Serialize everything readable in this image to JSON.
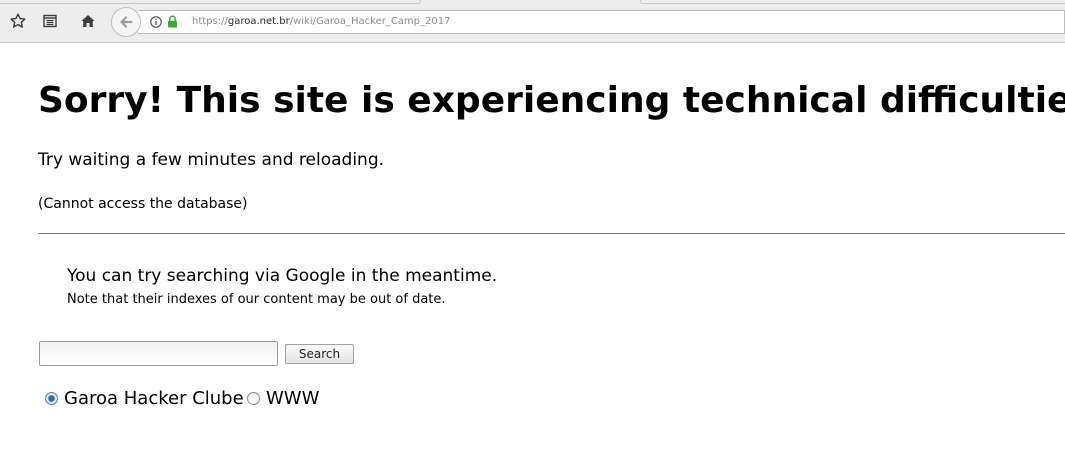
{
  "browser": {
    "url_prefix": "https://",
    "url_host": "garoa.net.br",
    "url_path": "/wiki/Garoa_Hacker_Camp_2017",
    "icons": {
      "bookmark": "star-icon",
      "reader": "reader-view-icon",
      "home": "home-icon",
      "back": "back-arrow-icon",
      "info": "info-icon",
      "lock": "lock-icon"
    },
    "lock_color": "#3aa935"
  },
  "error": {
    "title": "Sorry! This site is experiencing technical difficulties.",
    "message": "Try waiting a few minutes and reloading.",
    "detail": "(Cannot access the database)"
  },
  "search": {
    "lead": "You can try searching via Google in the meantime.",
    "note": "Note that their indexes of our content may be out of date.",
    "input_value": "",
    "button_label": "Search",
    "options": [
      {
        "label": "Garoa Hacker Clube",
        "checked": true
      },
      {
        "label": "WWW",
        "checked": false
      }
    ]
  }
}
